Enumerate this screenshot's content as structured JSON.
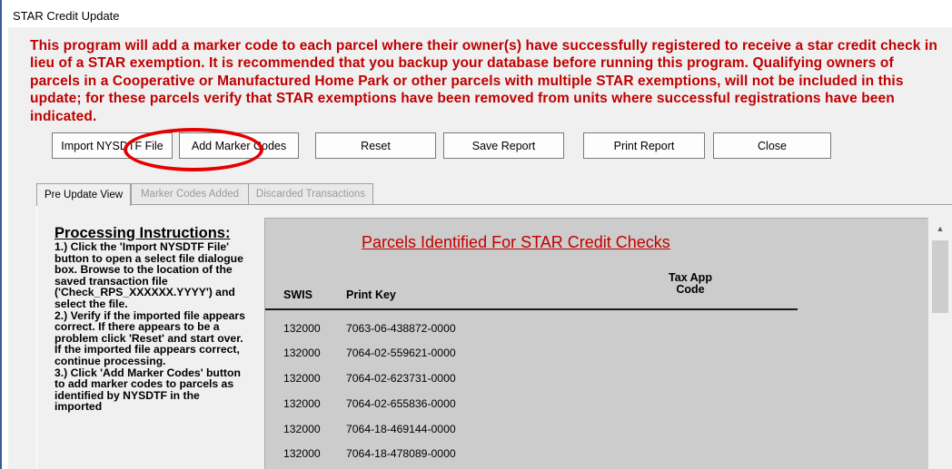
{
  "window": {
    "title": "STAR Credit Update"
  },
  "intro_text": "This program will add a marker code to each parcel where their owner(s) have successfully registered to receive a star credit check in lieu of a STAR exemption.  It is recommended that you backup your database before running this program.  Qualifying owners of parcels in a Cooperative or Manufactured Home Park or other parcels with multiple STAR exemptions, will not be included in this update; for these parcels verify that STAR exemptions have been removed from units where successful registrations have been indicated.",
  "toolbar": {
    "import_label": "Import NYSDTF File",
    "add_marker_label": "Add Marker Codes",
    "reset_label": "Reset",
    "save_label": "Save Report",
    "print_label": "Print Report",
    "close_label": "Close"
  },
  "tabs": [
    {
      "label": "Pre Update View",
      "active": true
    },
    {
      "label": "Marker Codes Added",
      "active": false
    },
    {
      "label": "Discarded Transactions",
      "active": false
    }
  ],
  "instructions": {
    "heading": "Processing Instructions:",
    "body": "1.) Click the 'Import NYSDTF File' button to open a select file dialogue box.  Browse to the location of the saved transaction file ('Check_RPS_XXXXXX.YYYY') and select the file.\n2.) Verify if the imported file appears correct.  If there appears to be a problem click 'Reset' and start over.  If the imported file appears correct, continue processing.\n3.) Click 'Add Marker Codes' button to add marker codes to parcels as identified by NYSDTF in the imported"
  },
  "parcel_list": {
    "title": "Parcels Identified For  STAR Credit Checks",
    "columns": {
      "swis": "SWIS",
      "print_key": "Print Key",
      "tax_app_code": "Tax App\nCode"
    },
    "rows": [
      {
        "swis": "132000",
        "print_key": "7063-06-438872-0000"
      },
      {
        "swis": "132000",
        "print_key": "7064-02-559621-0000"
      },
      {
        "swis": "132000",
        "print_key": "7064-02-623731-0000"
      },
      {
        "swis": "132000",
        "print_key": "7064-02-655836-0000"
      },
      {
        "swis": "132000",
        "print_key": "7064-18-469144-0000"
      },
      {
        "swis": "132000",
        "print_key": "7064-18-478089-0000"
      }
    ]
  },
  "colors": {
    "intro_text": "#c00000",
    "annotation_ellipse": "#e60000",
    "list_background": "#cccccc"
  },
  "annotation": {
    "shape": "ellipse",
    "highlights": "add-marker-codes-button"
  },
  "icons": {
    "scroll_up": "chevron-up-icon"
  }
}
